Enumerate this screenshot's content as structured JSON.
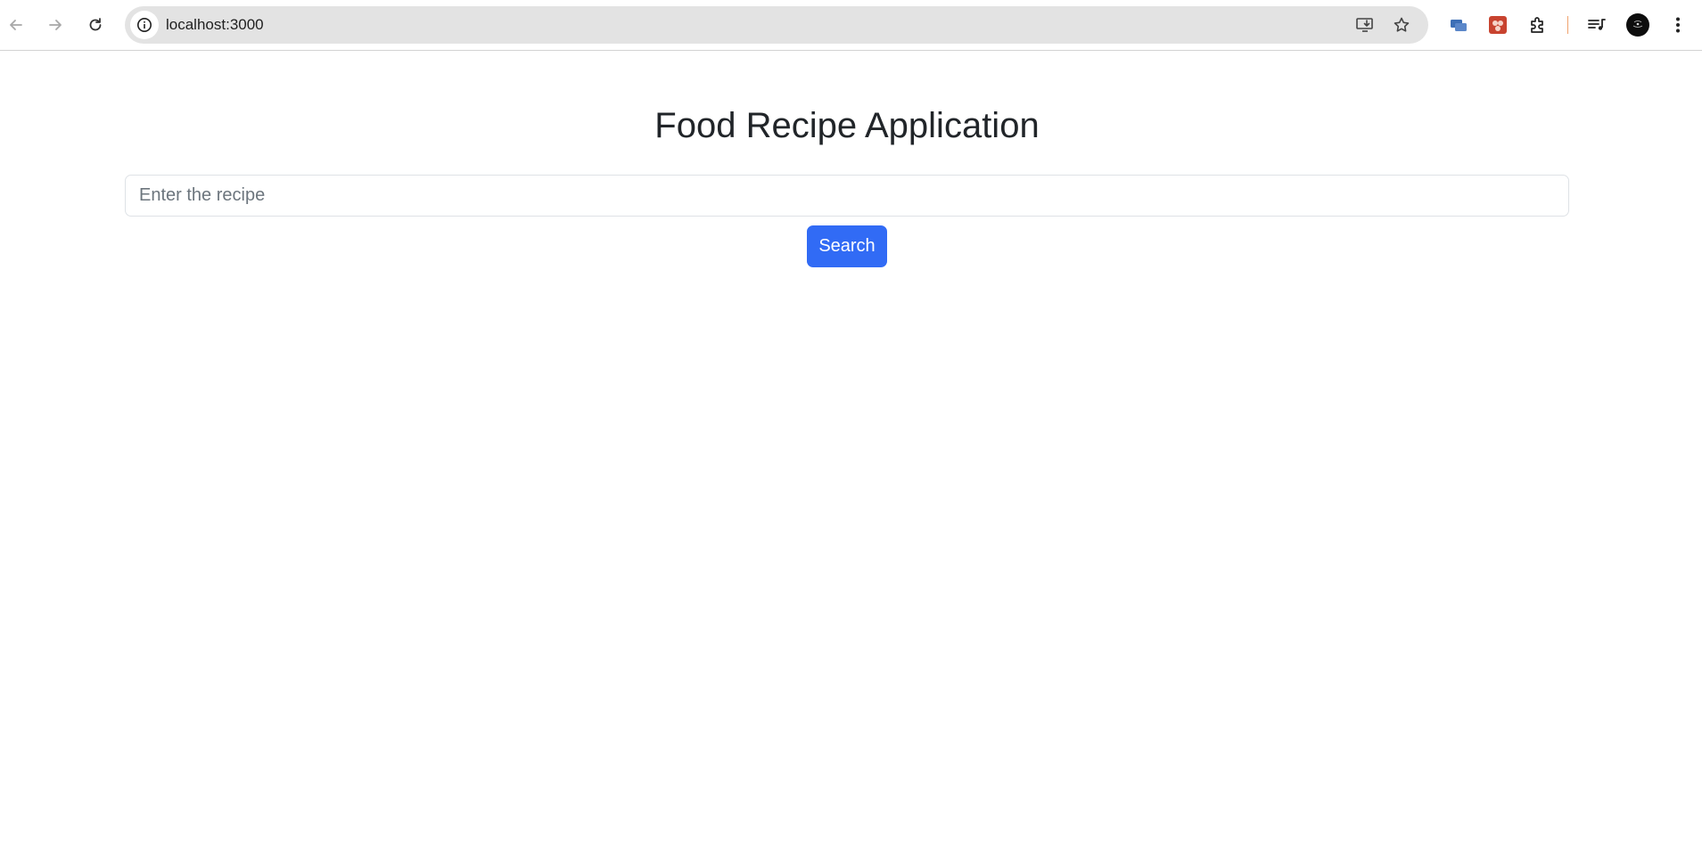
{
  "browser": {
    "url": "localhost:3000",
    "icons": {
      "back": "back-arrow-icon",
      "forward": "forward-arrow-icon",
      "reload": "reload-icon",
      "site_info": "info-icon",
      "install": "install-app-icon",
      "bookmark": "star-icon",
      "extension_1": "extension-chat-icon",
      "extension_2": "extension-red-icon",
      "extensions_menu": "puzzle-icon",
      "media": "media-queue-icon",
      "profile": "avatar-icon",
      "menu": "kebab-menu-icon"
    }
  },
  "page": {
    "title": "Food Recipe Application",
    "search": {
      "placeholder": "Enter the recipe",
      "value": ""
    },
    "search_button_label": "Search"
  },
  "colors": {
    "primary_button": "#316bf5",
    "heading": "#212529",
    "omnibox_bg": "#e3e3e3"
  }
}
